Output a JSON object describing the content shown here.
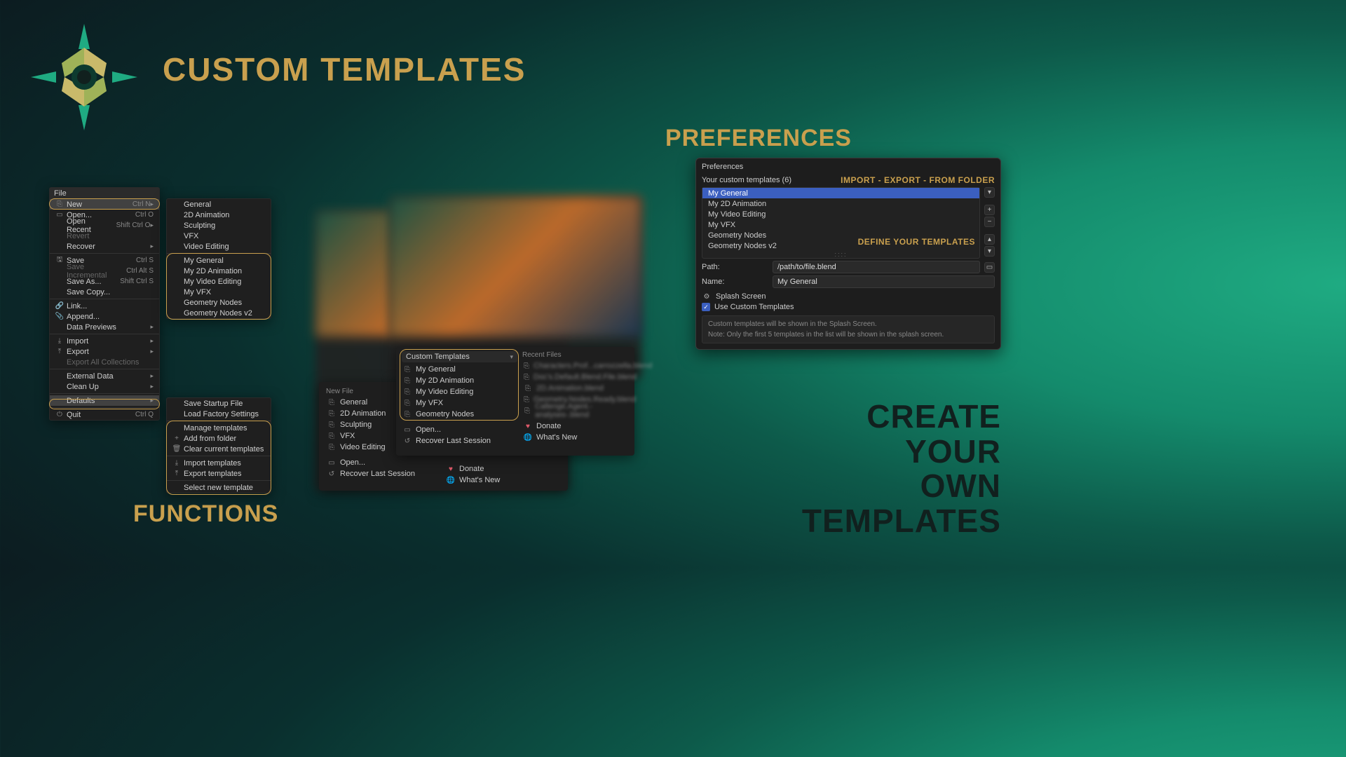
{
  "title": "CUSTOM TEMPLATES",
  "tag_right": [
    "CREATE",
    "YOUR",
    "OWN",
    "TEMPLATES"
  ],
  "tag_functions": "FUNCTIONS",
  "tag_preferences": "PREFERENCES",
  "file_menu": {
    "title": "File",
    "items": [
      {
        "icon": "⎘",
        "label": "New",
        "shortcut": "Ctrl N",
        "arrow": true,
        "hi": true
      },
      {
        "icon": "▭",
        "label": "Open...",
        "shortcut": "Ctrl O"
      },
      {
        "label": "Open Recent",
        "shortcut": "Shift Ctrl O",
        "arrow": true
      },
      {
        "label": "Revert",
        "disabled": true
      },
      {
        "label": "Recover",
        "arrow": true
      },
      {
        "sep": true
      },
      {
        "icon": "🖫",
        "label": "Save",
        "shortcut": "Ctrl S"
      },
      {
        "label": "Save Incremental",
        "shortcut": "Ctrl Alt S",
        "disabled": true
      },
      {
        "label": "Save As...",
        "shortcut": "Shift Ctrl S"
      },
      {
        "label": "Save Copy..."
      },
      {
        "sep": true
      },
      {
        "icon": "🔗",
        "label": "Link..."
      },
      {
        "icon": "📎",
        "label": "Append..."
      },
      {
        "label": "Data Previews",
        "arrow": true
      },
      {
        "sep": true
      },
      {
        "icon": "⤓",
        "label": "Import",
        "arrow": true
      },
      {
        "icon": "⤒",
        "label": "Export",
        "arrow": true
      },
      {
        "label": "Export All Collections",
        "disabled": true
      },
      {
        "sep": true
      },
      {
        "label": "External Data",
        "arrow": true
      },
      {
        "label": "Clean Up",
        "arrow": true
      },
      {
        "sep": true
      },
      {
        "label": "Defaults",
        "arrow": true,
        "hi": true
      },
      {
        "sep": true
      },
      {
        "icon": "⏻",
        "label": "Quit",
        "shortcut": "Ctrl Q"
      }
    ]
  },
  "new_submenu": {
    "builtin": [
      "General",
      "2D Animation",
      "Sculpting",
      "VFX",
      "Video Editing"
    ],
    "custom": [
      "My General",
      "My 2D Animation",
      "My Video Editing",
      "My VFX",
      "Geometry Nodes",
      "Geometry Nodes v2"
    ]
  },
  "defaults_submenu": {
    "top": [
      "Save Startup File",
      "Load Factory Settings"
    ],
    "manage": [
      {
        "label": "Manage templates"
      },
      {
        "icon": "+",
        "label": "Add from folder"
      },
      {
        "icon": "🗑",
        "label": "Clear current templates"
      }
    ],
    "io": [
      {
        "icon": "⤓",
        "label": "Import templates"
      },
      {
        "icon": "⤒",
        "label": "Export templates"
      }
    ],
    "last": "Select new template"
  },
  "splash1": {
    "new_file_title": "New File",
    "items": [
      "General",
      "2D Animation",
      "Sculpting",
      "VFX",
      "Video Editing"
    ],
    "open": "Open...",
    "recover": "Recover Last Session",
    "donate": "Donate",
    "whatsnew": "What's New"
  },
  "splash2": {
    "dropdown": "Custom Templates",
    "items": [
      "My General",
      "My 2D Animation",
      "My Video Editing",
      "My VFX",
      "Geometry Nodes"
    ],
    "recent_title": "Recent Files",
    "recent": [
      "Characters.Prof...carrozzella.blend",
      "Doc's.Default.Blend.File.blend",
      "2D.Animation.blend",
      "Geometry.Nodes.Ready.blend",
      "Callenge.Agent.-analyses-.blend"
    ],
    "open": "Open...",
    "recover": "Recover Last Session",
    "donate": "Donate",
    "whatsnew": "What's New"
  },
  "prefs": {
    "title": "Preferences",
    "count_label": "Your custom templates (6)",
    "import_export": "IMPORT - EXPORT - FROM FOLDER",
    "define": "DEFINE YOUR TEMPLATES",
    "list": [
      "My General",
      "My 2D Animation",
      "My Video Editing",
      "My VFX",
      "Geometry Nodes",
      "Geometry Nodes v2"
    ],
    "path_label": "Path:",
    "path": "/path/to/file.blend",
    "name_label": "Name:",
    "name": "My General",
    "splash": "Splash Screen",
    "use": "Use Custom Templates",
    "note1": "Custom templates will be shown in the Splash Screen.",
    "note2": "Note: Only the first 5 templates in the list will be shown in the splash screen."
  }
}
